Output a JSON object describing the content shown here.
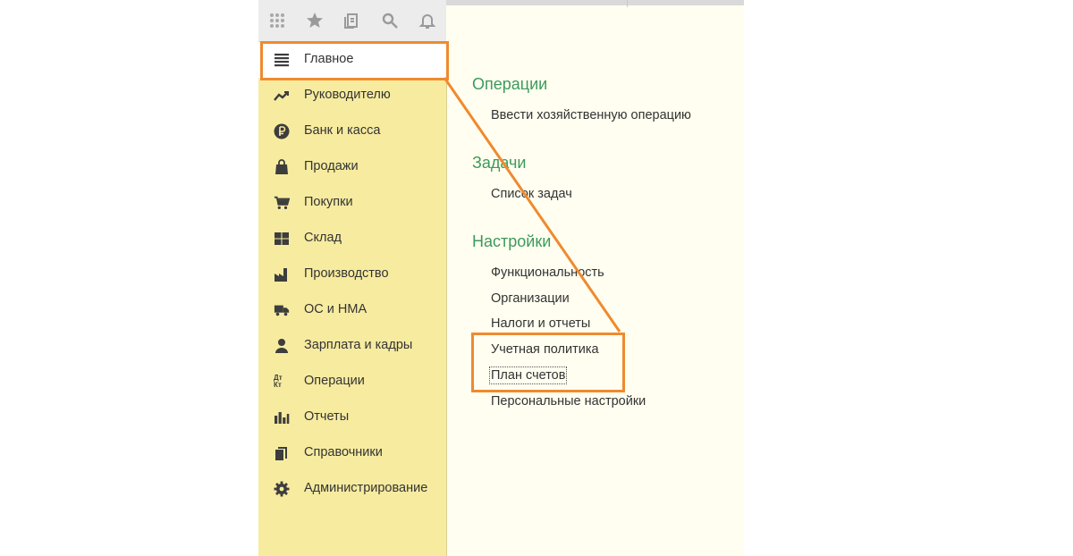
{
  "toolbar": {
    "buttons": [
      {
        "name": "apps-grid-icon"
      },
      {
        "name": "star-icon"
      },
      {
        "name": "history-icon"
      },
      {
        "name": "search-icon"
      },
      {
        "name": "bell-icon"
      }
    ]
  },
  "sidebar": {
    "items": [
      {
        "label": "Главное",
        "icon": "menu-icon"
      },
      {
        "label": "Руководителю",
        "icon": "trend-icon"
      },
      {
        "label": "Банк и касса",
        "icon": "ruble-icon"
      },
      {
        "label": "Продажи",
        "icon": "bag-icon"
      },
      {
        "label": "Покупки",
        "icon": "cart-icon"
      },
      {
        "label": "Склад",
        "icon": "warehouse-icon"
      },
      {
        "label": "Производство",
        "icon": "factory-icon"
      },
      {
        "label": "ОС и НМА",
        "icon": "truck-icon"
      },
      {
        "label": "Зарплата и кадры",
        "icon": "person-icon"
      },
      {
        "label": "Операции",
        "icon": "dt-kt-icon",
        "icon_text": "Дт Кт"
      },
      {
        "label": "Отчеты",
        "icon": "bar-chart-icon"
      },
      {
        "label": "Справочники",
        "icon": "books-icon"
      },
      {
        "label": "Администрирование",
        "icon": "gear-icon"
      }
    ]
  },
  "main": {
    "sections": [
      {
        "title": "Операции",
        "links": [
          "Ввести хозяйственную операцию"
        ]
      },
      {
        "title": "Задачи",
        "links": [
          "Список задач"
        ]
      },
      {
        "title": "Настройки",
        "links": [
          "Функциональность",
          "Организации",
          "Налоги и отчеты",
          "Учетная политика",
          "План счетов",
          "Персональные настройки"
        ]
      }
    ]
  },
  "colors": {
    "highlight": "#ef8a2f",
    "section_title": "#3c9a5c",
    "sidebar_bg": "#f7eba0"
  }
}
